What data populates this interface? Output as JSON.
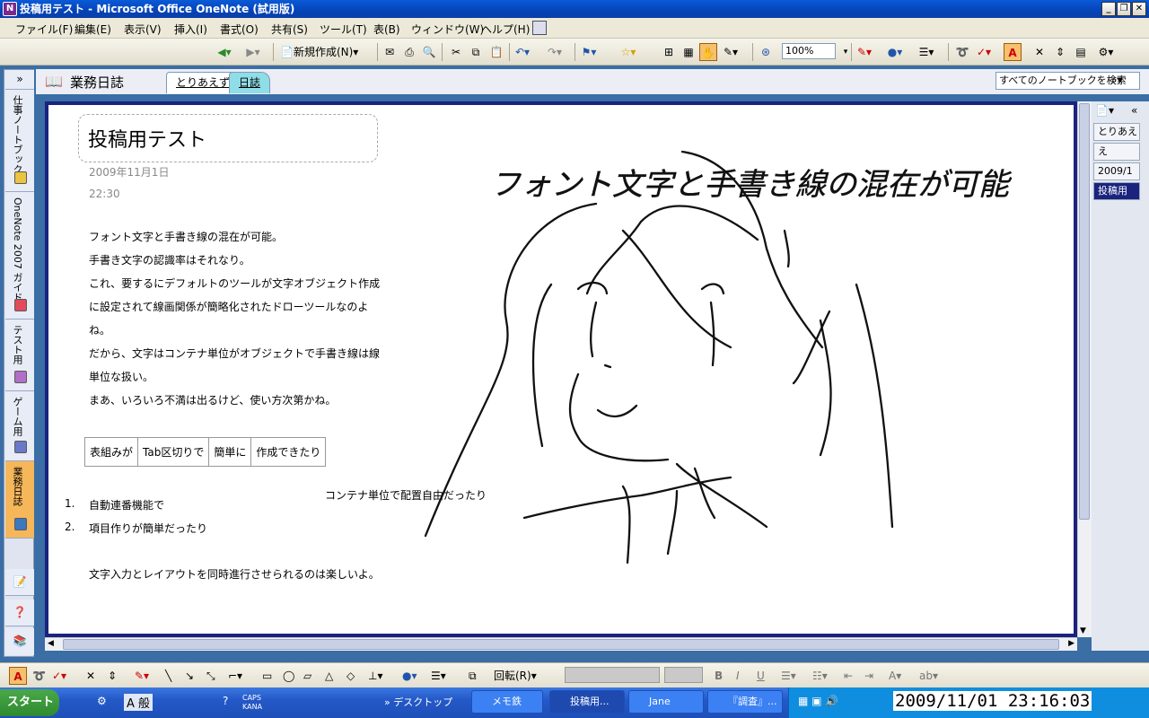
{
  "titlebar": {
    "title": "投稿用テスト - Microsoft Office OneNote (試用版)",
    "min": "_",
    "max": "❐",
    "close": "✕"
  },
  "menu": [
    "ファイル(F)",
    "編集(E)",
    "表示(V)",
    "挿入(I)",
    "書式(O)",
    "共有(S)",
    "ツール(T)",
    "表(B)",
    "ウィンドウ(W)",
    "ヘルプ(H)"
  ],
  "toolbar": {
    "new_label": "新規作成(N)",
    "zoom": "100%"
  },
  "notebooks": [
    {
      "label": "仕事ノートブック",
      "color": "#e8c440"
    },
    {
      "label": "OneNote 2007 ガイド",
      "color": "#e04a5a"
    },
    {
      "label": "テスト用",
      "color": "#b070c8"
    },
    {
      "label": "ゲーム用",
      "color": "#6a78c8"
    },
    {
      "label": "業務日誌",
      "color": "#f5b75a",
      "active": true
    }
  ],
  "header": {
    "notebook_title": "業務日誌",
    "tabs": [
      "とりあえず",
      "日誌"
    ],
    "search_placeholder": "すべてのノートブックを検索"
  },
  "page": {
    "title": "投稿用テスト",
    "date": "2009年11月1日",
    "time": "22:30",
    "lines": [
      "フォント文字と手書き線の混在が可能。",
      "手書き文字の認識率はそれなり。",
      "これ、要するにデフォルトのツールが文字オブジェクト作成",
      "に設定されて線画関係が簡略化されたドローツールなのよ",
      "ね。",
      "だから、文字はコンテナ単位がオブジェクトで手書き線は線",
      "単位な扱い。",
      "まあ、いろいろ不満は出るけど、使い方次第かね。"
    ],
    "table": [
      "表組みが",
      "Tab区切りで",
      "簡単に",
      "作成できたり"
    ],
    "floating_note": "コンテナ単位で配置自由だったり",
    "list": [
      {
        "num": "1.",
        "text": "自動連番機能で"
      },
      {
        "num": "2.",
        "text": "項目作りが簡単だったり"
      }
    ],
    "closing": "文字入力とレイアウトを同時進行させられるのは楽しいよ。",
    "handwriting": "フォント文字と手書き線の混在が可能"
  },
  "page_tabs": [
    "とりあえ",
    "え",
    "2009/1",
    "投稿用"
  ],
  "drawbar": {
    "rotate_label": "回転(R)"
  },
  "taskbar": {
    "start": "スタート",
    "ime": "A 般",
    "caps": "CAPS KANA",
    "desktop": "デスクトップ",
    "tasks": [
      "メモ鉄",
      "投稿用...",
      "Jane",
      "『調査』..."
    ],
    "clock": "2009/11/01  23:16:03"
  }
}
